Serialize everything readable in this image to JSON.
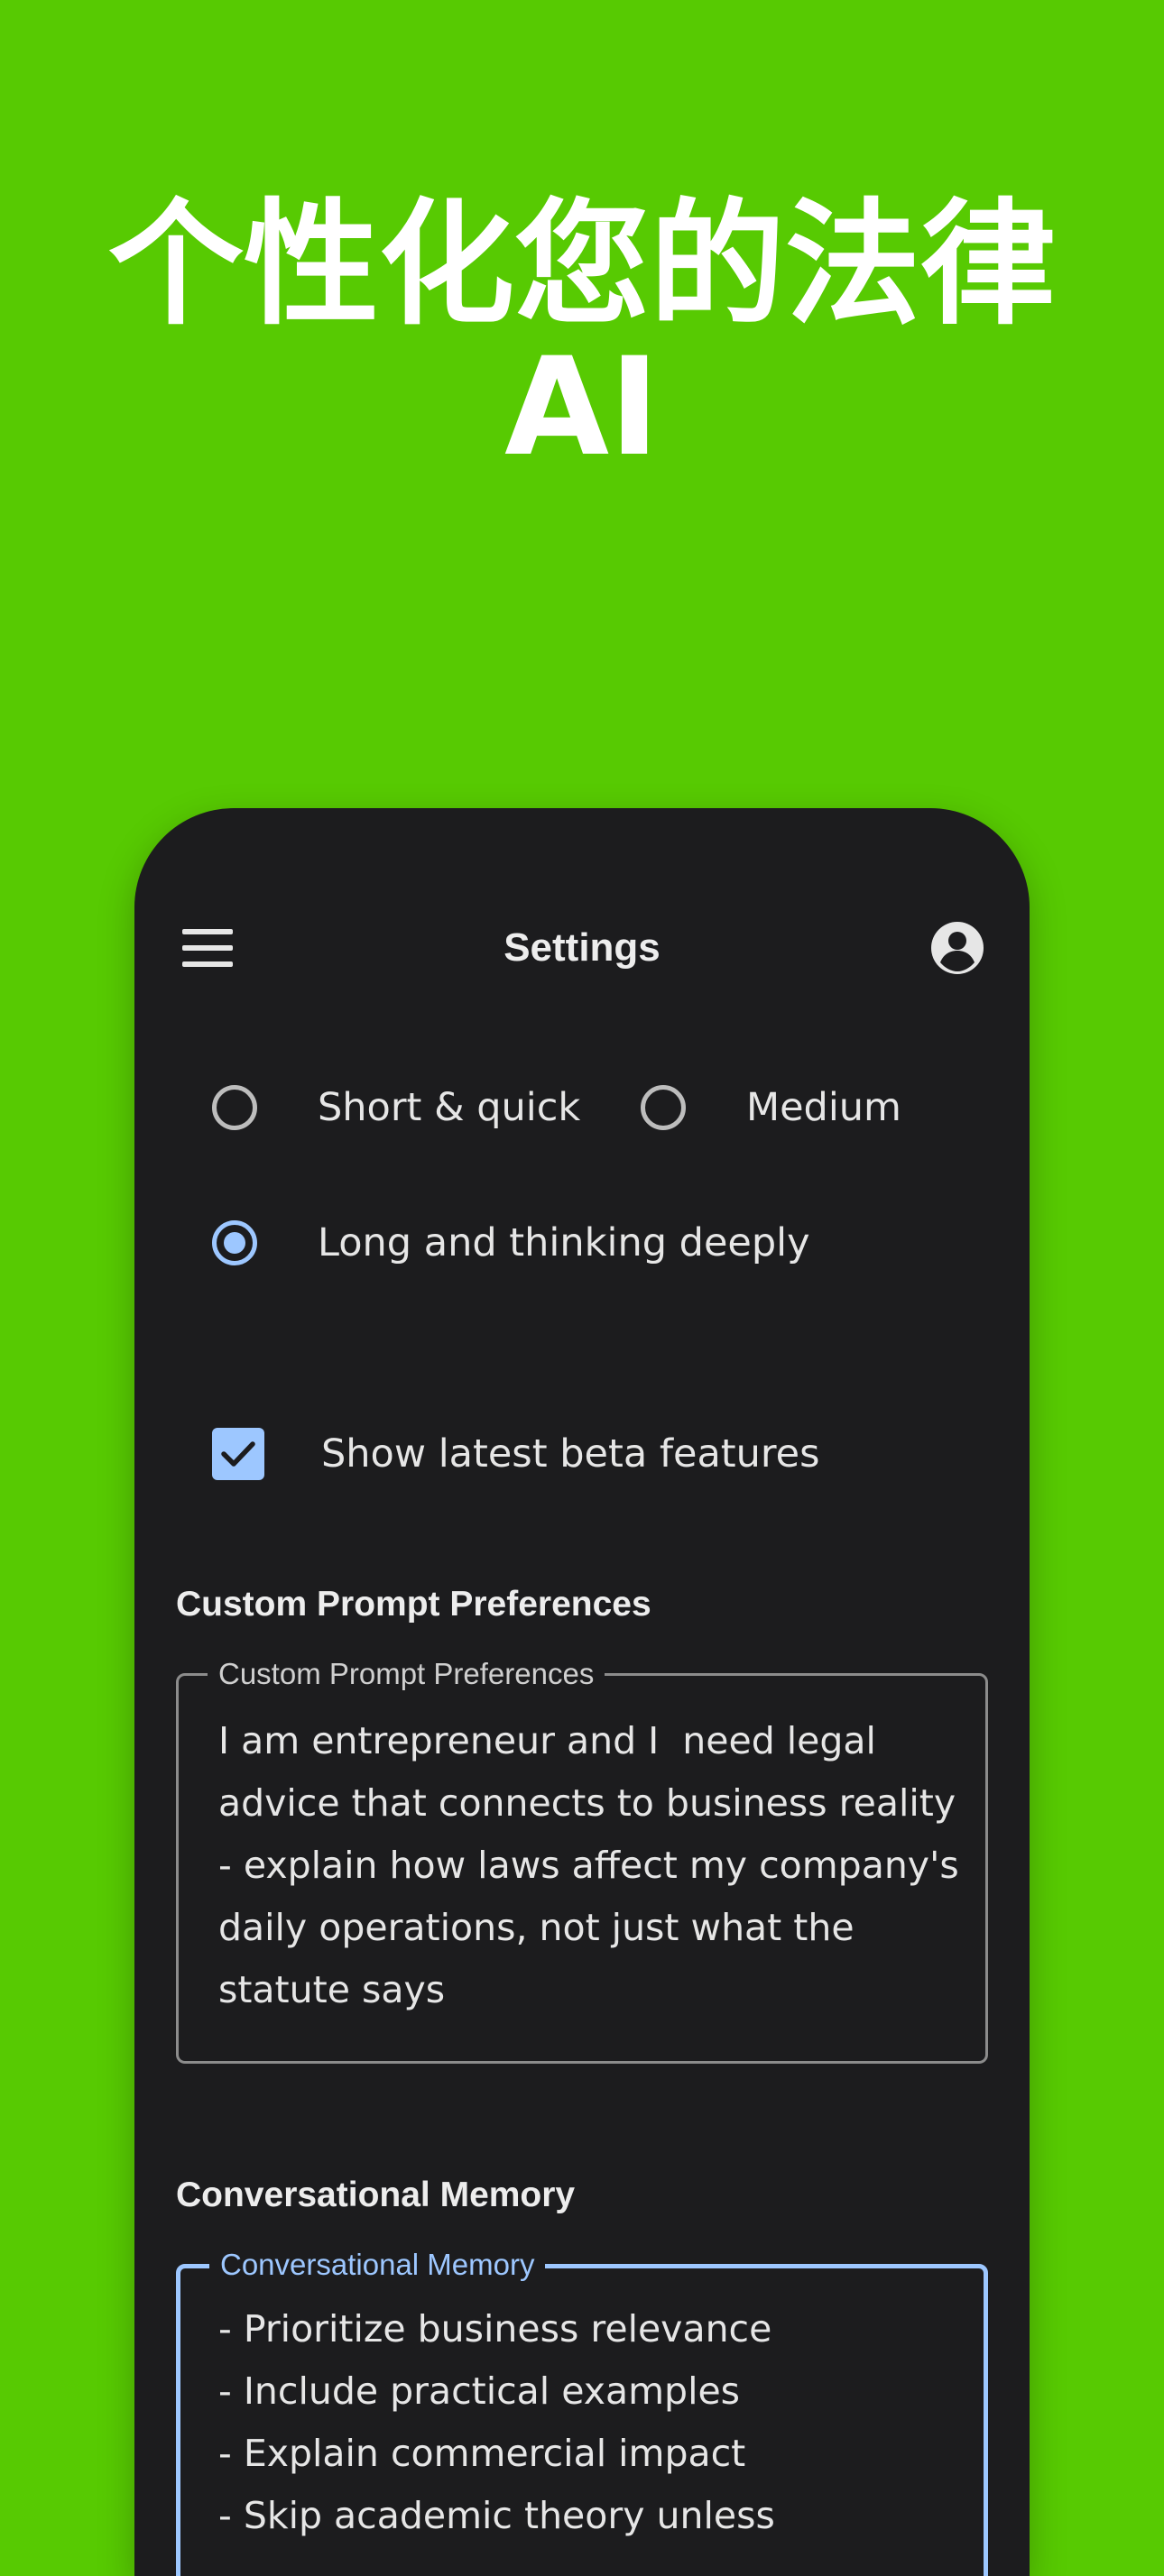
{
  "headline": {
    "line1": "个性化您的法律",
    "line2": "AI"
  },
  "app_bar": {
    "title": "Settings",
    "menu_icon": "hamburger-menu-icon",
    "account_icon": "account-circle-icon"
  },
  "response_length": {
    "options": [
      {
        "label": "Short & quick",
        "selected": false
      },
      {
        "label": "Medium",
        "selected": false
      },
      {
        "label": "Long and thinking deeply",
        "selected": true
      }
    ]
  },
  "beta": {
    "label": "Show latest beta features",
    "checked": true
  },
  "custom_prompt": {
    "section_title": "Custom Prompt Preferences",
    "field_label": "Custom Prompt Preferences",
    "value": "I am entrepreneur and I  need legal advice that connects to business reality - explain how laws affect my company's daily operations, not just what the statute says"
  },
  "memory": {
    "section_title": "Conversational Memory",
    "field_label": "Conversational Memory",
    "value": "- Prioritize business relevance\n- Include practical examples\n- Explain commercial impact\n- Skip academic theory unless"
  },
  "colors": {
    "background": "#57CA02",
    "panel": "#1C1C1E",
    "accent": "#9DC7FF",
    "text": "#E6E6E6"
  }
}
